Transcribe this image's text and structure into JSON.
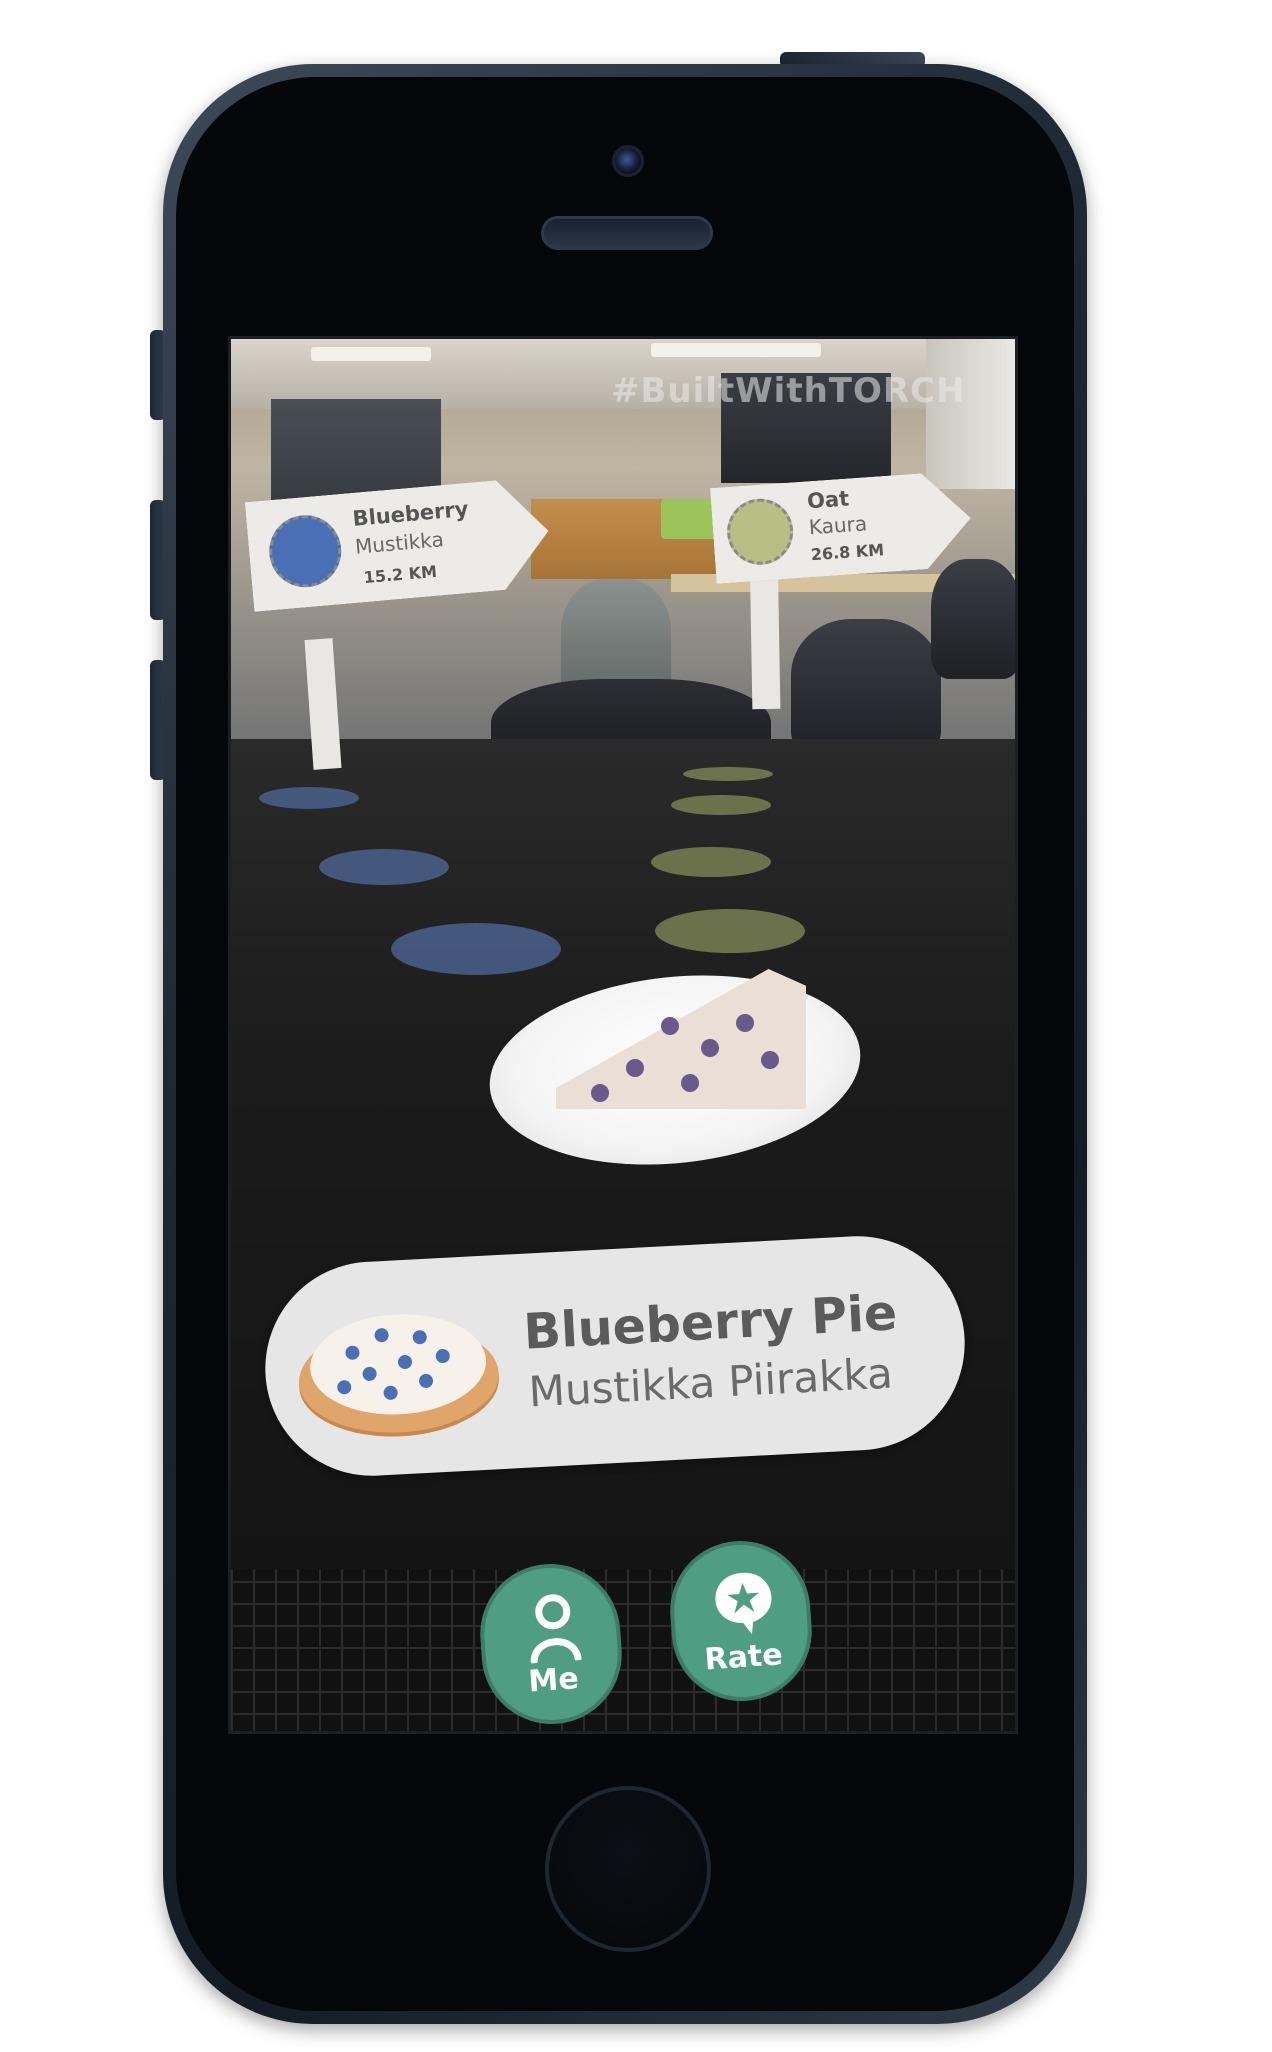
{
  "watermark": "#BuiltWithTORCH",
  "signposts": [
    {
      "title": "Blueberry",
      "subtitle": "Mustikka",
      "distance": "15.2 KM",
      "icon": "blueberry-icon",
      "color": "#4a6fb5"
    },
    {
      "title": "Oat",
      "subtitle": "Kaura",
      "distance": "26.8 KM",
      "icon": "oat-icon",
      "color": "#b7bf86"
    }
  ],
  "food_card": {
    "title": "Blueberry Pie",
    "subtitle": "Mustikka Piirakka",
    "icon": "blueberry-pie-icon"
  },
  "actions": {
    "me_label": "Me",
    "rate_label": "Rate",
    "accent_color": "#4f9e84"
  }
}
